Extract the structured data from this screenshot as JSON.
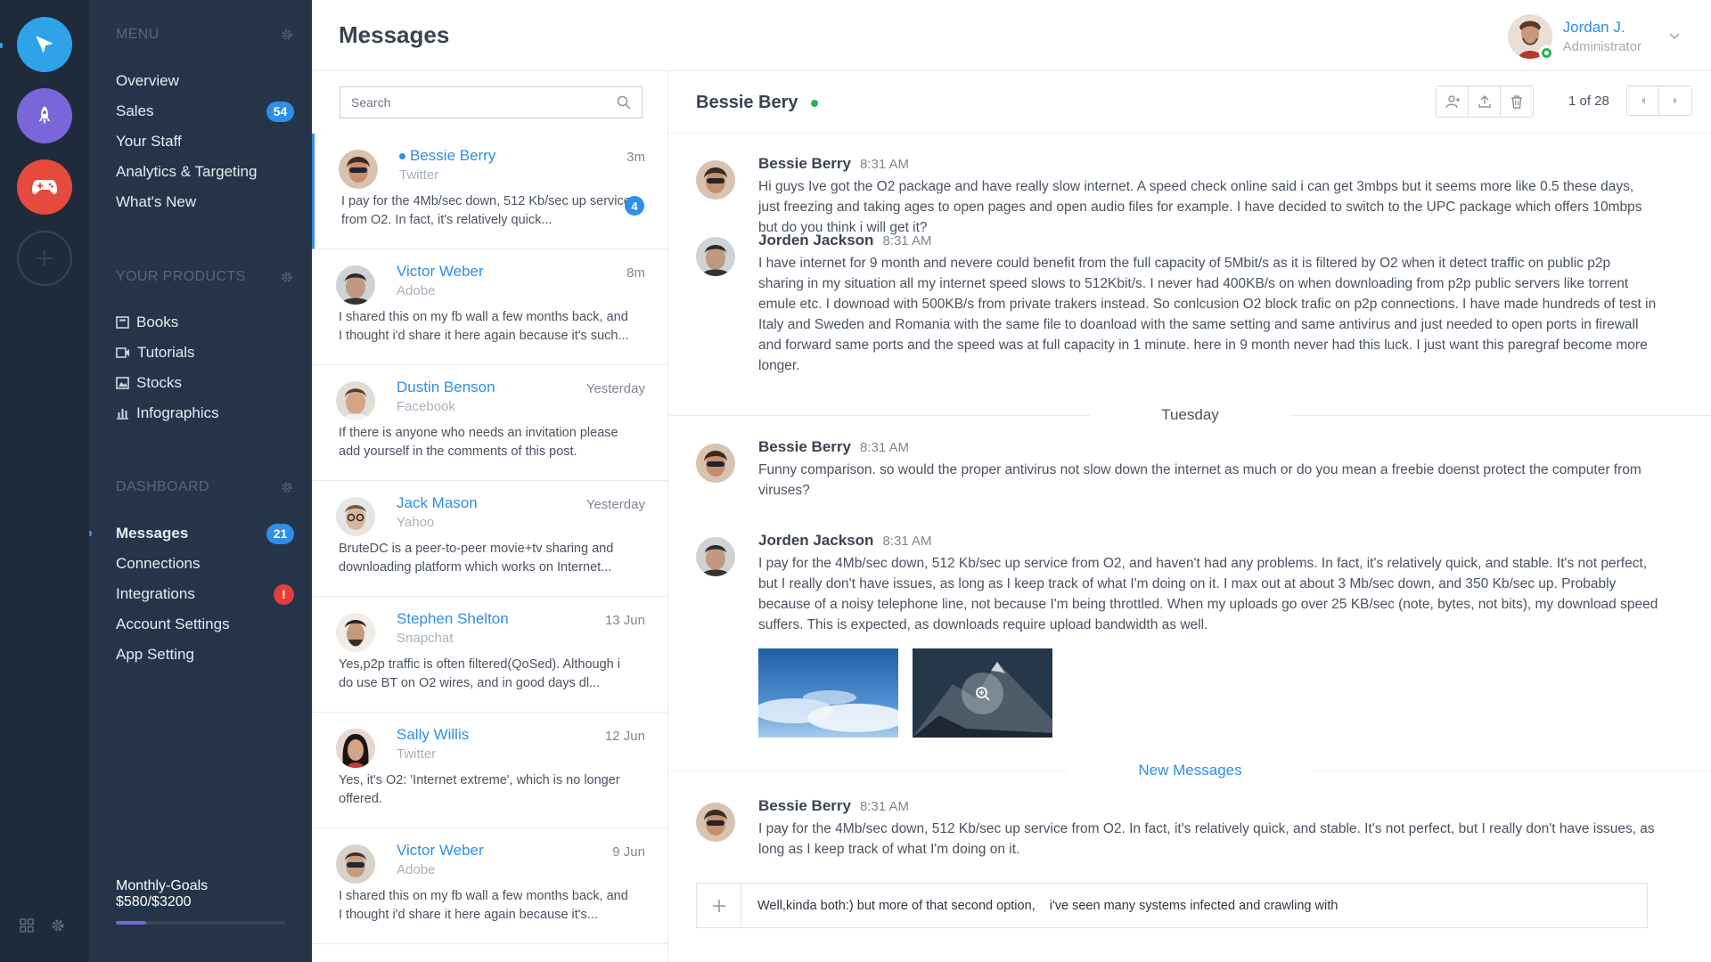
{
  "colors": {
    "accent": "#2e8ee8",
    "online": "#27b35a",
    "alert": "#e63c3c",
    "sidebar": "#26344a",
    "rail": "#1f2a3a",
    "purple": "#7a66d8"
  },
  "rail": {
    "apps": [
      {
        "name": "send-app",
        "icon": "paper-plane-icon",
        "color": "#2ea3e9"
      },
      {
        "name": "rocket-app",
        "icon": "rocket-icon",
        "color": "#7a66d8"
      },
      {
        "name": "game-app",
        "icon": "gamepad-icon",
        "color": "#e64a3c"
      }
    ],
    "add_icon": "plus-icon",
    "bottom_icons": [
      "grid-icon",
      "gear-icon"
    ]
  },
  "sidebar": {
    "menu": {
      "title": "MENU",
      "items": [
        {
          "label": "Overview"
        },
        {
          "label": "Sales",
          "badge": "54"
        },
        {
          "label": "Your Staff"
        },
        {
          "label": "Analytics & Targeting"
        },
        {
          "label": "What's New"
        }
      ]
    },
    "products": {
      "title": "YOUR PRODUCTS",
      "items": [
        {
          "label": "Books",
          "icon": "book-icon"
        },
        {
          "label": "Tutorials",
          "icon": "video-icon"
        },
        {
          "label": "Stocks",
          "icon": "image-icon"
        },
        {
          "label": "Infographics",
          "icon": "bar-chart-icon"
        }
      ]
    },
    "dashboard": {
      "title": "DASHBOARD",
      "items": [
        {
          "label": "Messages",
          "badge": "21"
        },
        {
          "label": "Connections"
        },
        {
          "label": "Integrations",
          "badge": "!"
        },
        {
          "label": "Account Settings"
        },
        {
          "label": "App Setting"
        }
      ]
    },
    "goals": {
      "label": "Monthly-Goals $580/$3200",
      "progress": 0.181
    }
  },
  "header": {
    "title": "Messages",
    "user": {
      "name": "Jordan J.",
      "role": "Administrator"
    }
  },
  "search": {
    "placeholder": "Search"
  },
  "conversations": [
    {
      "name": "Bessie Berry",
      "source": "Twitter",
      "time": "3m",
      "preview": "I pay for the 4Mb/sec down, 512 Kb/sec up service from O2. In fact, it's relatively quick...",
      "badge": "4",
      "unread": true
    },
    {
      "name": "Victor Weber",
      "source": "Adobe",
      "time": "8m",
      "preview": "I shared this on my fb wall a few months back, and I thought i'd share it here again because it's such..."
    },
    {
      "name": "Dustin Benson",
      "source": "Facebook",
      "time": "Yesterday",
      "preview": "If there is anyone who needs an invitation please add yourself in the comments of this post."
    },
    {
      "name": "Jack Mason",
      "source": "Yahoo",
      "time": "Yesterday",
      "preview": "BruteDC is a peer-to-peer movie+tv sharing and downloading platform which works on Internet..."
    },
    {
      "name": "Stephen Shelton",
      "source": "Snapchat",
      "time": "13 Jun",
      "preview": "Yes,p2p traffic is often filtered(QoSed). Although i do use BT on O2 wires, and in good days dl..."
    },
    {
      "name": "Sally Willis",
      "source": "Twitter",
      "time": "12 Jun",
      "preview": "Yes, it's O2: 'Internet extreme', which is no longer offered."
    },
    {
      "name": "Victor Weber",
      "source": "Adobe",
      "time": "9 Jun",
      "preview": "I shared this on my fb wall a few months back, and I thought i'd share it here again because it's..."
    }
  ],
  "chat": {
    "contact": "Bessie Bery",
    "toolbar_icons": [
      "add-user-icon",
      "upload-icon",
      "trash-icon"
    ],
    "pager": {
      "text": "1 of 28"
    },
    "messages": [
      {
        "author": "Bessie Berry",
        "time": "8:31 AM",
        "text": "Hi guys Ive got the O2 package and have really slow internet. A speed check online said i can get 3mbps but it seems more like 0.5 these days, just freezing and taking ages to open pages and open audio files for example. I have decided to switch to the UPC package which offers 10mbps but do you think i will get it?"
      },
      {
        "author": "Jorden Jackson",
        "time": "8:31 AM",
        "text": "I have internet for 9 month and nevere could benefit from the full capacity of 5Mbit/s as it is filtered by O2 when it detect traffic on public p2p sharing in my situation all my internet speed slows to 512Kbit/s. I never had 400KB/s on when downloading from p2p public servers like torrent emule etc. I downoad with 500KB/s from private trakers instead. So conlcusion O2 block trafic on p2p connections. I have made hundreds of test in Italy and Sweden and Romania with the same file to doanload with the same setting and same antivirus and just needed to open ports in firewall and forward same ports and the speed was at full capacity in 1 minute. here in 9 month never had this luck. I just want this paregraf become more longer."
      },
      {
        "author": "Bessie Berry",
        "time": "8:31 AM",
        "text": "Funny comparison. so would the proper antivirus not slow down the internet as much or do you mean a freebie doenst protect the computer from viruses?"
      },
      {
        "author": "Jorden Jackson",
        "time": "8:31 AM",
        "text": "I pay for the 4Mb/sec down, 512 Kb/sec up service from O2, and haven't had any problems. In fact, it's relatively quick, and stable. It's not perfect, but I really don't have issues, as long as I keep track of what I'm doing on it. I max out at about 3 Mb/sec down, and 350 Kb/sec up. Probably because of a noisy telephone line, not because I'm being throttled. When my uploads go over 25 KB/sec (note, bytes, not bits), my download speed suffers. This is expected, as downloads require upload bandwidth as well."
      },
      {
        "author": "Bessie Berry",
        "time": "8:31 AM",
        "text": "I pay for the 4Mb/sec down, 512 Kb/sec up service from O2. In fact, it's relatively quick, and stable. It's not perfect, but I really don't have issues, as long as I keep track of what I'm doing on it."
      }
    ],
    "dividers": {
      "day": "Tuesday",
      "new": "New Messages"
    },
    "attachments": [
      "sky-image",
      "mountain-image"
    ],
    "composer": {
      "value": "Well,kinda both:) but more of that second option,    i've seen many systems infected and crawling with"
    }
  }
}
